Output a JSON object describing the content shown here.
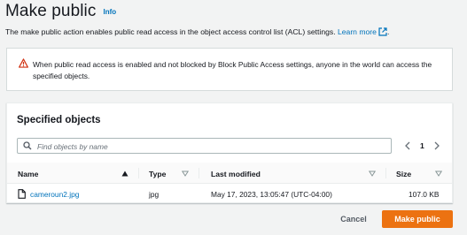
{
  "header": {
    "title": "Make public",
    "info_label": "Info"
  },
  "description": {
    "text": "The make public action enables public read access in the object access control list (ACL) settings. ",
    "link_label": "Learn more"
  },
  "alert": {
    "icon": "warning-triangle-icon",
    "text": "When public read access is enabled and not blocked by Block Public Access settings, anyone in the world can access the specified objects.",
    "icon_color": "#d13212"
  },
  "objects_panel": {
    "title": "Specified objects",
    "search_placeholder": "Find objects by name",
    "pagination": {
      "current_page": "1"
    },
    "columns": [
      {
        "label": "Name"
      },
      {
        "label": "Type"
      },
      {
        "label": "Last modified"
      },
      {
        "label": "Size"
      }
    ],
    "rows": [
      {
        "name": "cameroun2.jpg",
        "type": "jpg",
        "last_modified": "May 17, 2023, 13:05:47 (UTC-04:00)",
        "size": "107.0 KB"
      }
    ]
  },
  "footer": {
    "cancel_label": "Cancel",
    "submit_label": "Make public"
  },
  "colors": {
    "accent": "#ec7211",
    "link": "#0073bb",
    "background": "#f2f3f3"
  }
}
